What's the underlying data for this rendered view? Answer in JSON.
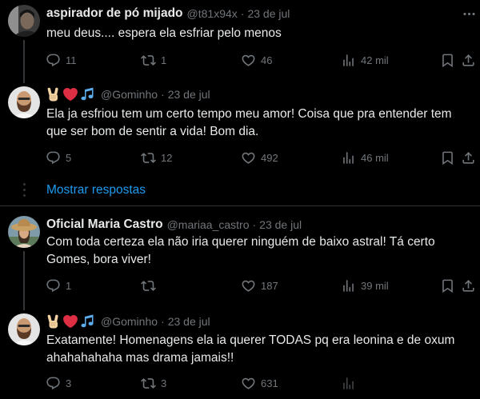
{
  "theme": {
    "background": "#000000",
    "text": "#e7e9ea",
    "muted": "#71767b",
    "link": "#1d9bf0",
    "divider": "#2f3336",
    "thread_line": "#333639"
  },
  "action_icons": [
    "reply-icon",
    "retweet-icon",
    "like-icon",
    "views-icon",
    "bookmark-icon",
    "share-icon"
  ],
  "tweets": [
    {
      "author_name": "aspirador de pó mijado",
      "handle": "@t81x94x",
      "separator": "·",
      "date": "23 de jul",
      "text": "meu deus.... espera ela esfriar pelo menos",
      "more_icon": "more-icon",
      "stats": {
        "replies": "11",
        "retweets": "1",
        "likes": "46",
        "views": "42 mil"
      }
    },
    {
      "author_emoji_icons": [
        "victory-hand-emoji-icon",
        "red-heart-emoji-icon",
        "musical-notes-emoji-icon"
      ],
      "handle": "@Gominho",
      "separator": "·",
      "date": "23 de jul",
      "text": "Ela ja esfriou tem um certo tempo meu amor! Coisa que pra entender tem que ser bom de sentir a vida! Bom dia.",
      "stats": {
        "replies": "5",
        "retweets": "12",
        "likes": "492",
        "views": "46 mil"
      }
    },
    {
      "author_name": "Oficial Maria Castro",
      "handle": "@mariaa_castro",
      "separator": "·",
      "date": "23 de jul",
      "text": "Com toda certeza ela não iria querer ninguém de baixo astral! Tá certo Gomes, bora viver!",
      "stats": {
        "replies": "1",
        "likes": "187",
        "views": "39 mil"
      }
    },
    {
      "author_emoji_icons": [
        "victory-hand-emoji-icon",
        "red-heart-emoji-icon",
        "musical-notes-emoji-icon"
      ],
      "handle": "@Gominho",
      "separator": "·",
      "date": "23 de jul",
      "text": "Exatamente! Homenagens ela ia querer TODAS pq era leonina e de oxum ahahahahaha mas drama jamais!!",
      "stats": {
        "replies": "3",
        "retweets": "3",
        "likes": "631"
      }
    }
  ],
  "show_replies_label": "Mostrar respostas"
}
